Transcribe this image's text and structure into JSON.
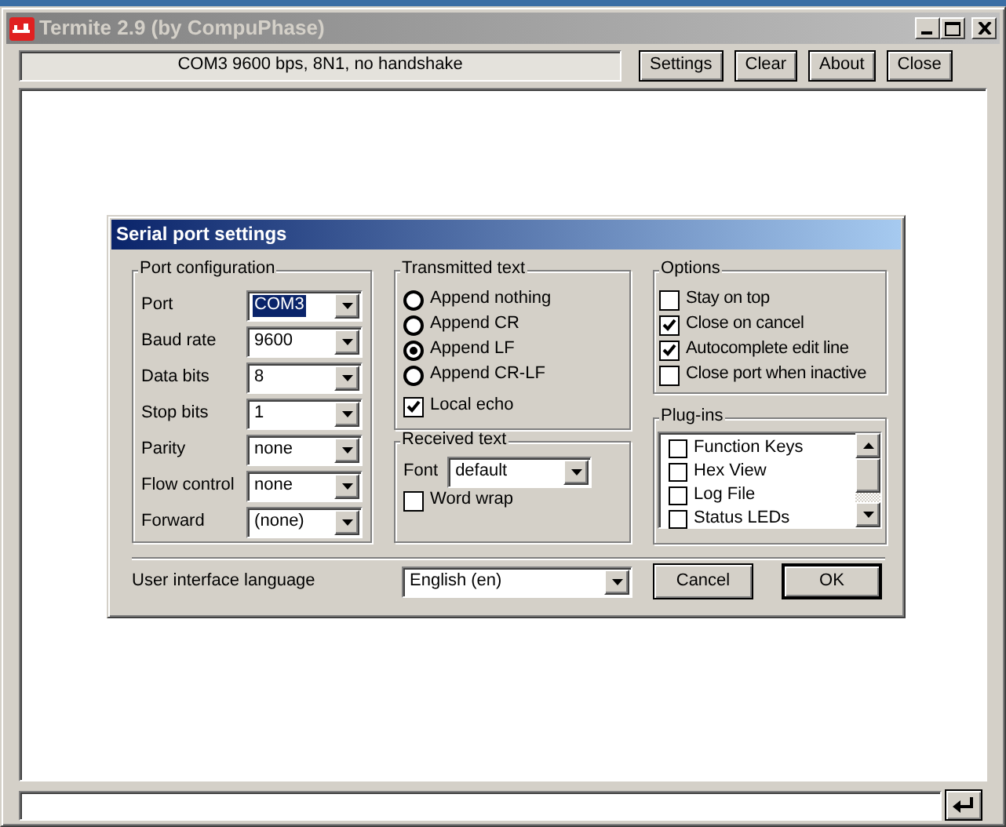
{
  "window": {
    "title": "Termite 2.9 (by CompuPhase)"
  },
  "toolbar": {
    "status": "COM3 9600 bps, 8N1, no handshake",
    "buttons": [
      "Settings",
      "Clear",
      "About",
      "Close"
    ]
  },
  "dialog": {
    "title": "Serial port settings",
    "port_configuration": {
      "title": "Port configuration",
      "fields": [
        {
          "label": "Port",
          "value": "COM3",
          "focused": true
        },
        {
          "label": "Baud rate",
          "value": "9600",
          "focused": false
        },
        {
          "label": "Data bits",
          "value": "8",
          "focused": false
        },
        {
          "label": "Stop bits",
          "value": "1",
          "focused": false
        },
        {
          "label": "Parity",
          "value": "none",
          "focused": false
        },
        {
          "label": "Flow control",
          "value": "none",
          "focused": false
        },
        {
          "label": "Forward",
          "value": "(none)",
          "focused": false
        }
      ]
    },
    "transmitted_text": {
      "title": "Transmitted text",
      "options": [
        {
          "label": "Append nothing",
          "selected": false
        },
        {
          "label": "Append CR",
          "selected": false
        },
        {
          "label": "Append LF",
          "selected": true
        },
        {
          "label": "Append CR-LF",
          "selected": false
        }
      ],
      "local_echo": {
        "label": "Local echo",
        "checked": true
      }
    },
    "received_text": {
      "title": "Received text",
      "font_label": "Font",
      "font_value": "default",
      "word_wrap": {
        "label": "Word wrap",
        "checked": false
      }
    },
    "options": {
      "title": "Options",
      "items": [
        {
          "label": "Stay on top",
          "checked": false
        },
        {
          "label": "Close on cancel",
          "checked": true
        },
        {
          "label": "Autocomplete edit line",
          "checked": true
        },
        {
          "label": "Close port when inactive",
          "checked": false
        }
      ]
    },
    "plugins": {
      "title": "Plug-ins",
      "items": [
        {
          "label": "Function Keys",
          "checked": false
        },
        {
          "label": "Hex View",
          "checked": false
        },
        {
          "label": "Log File",
          "checked": false
        },
        {
          "label": "Status LEDs",
          "checked": false
        }
      ]
    },
    "language": {
      "label": "User interface language",
      "value": "English (en)"
    },
    "buttons": [
      {
        "label": "Cancel",
        "default": false
      },
      {
        "label": "OK",
        "default": true
      }
    ]
  }
}
